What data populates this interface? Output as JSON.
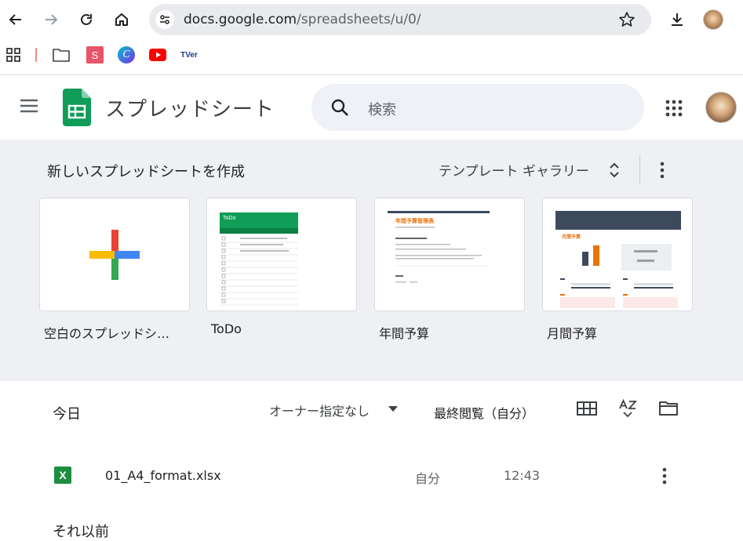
{
  "browser": {
    "url_host": "docs.google.com",
    "url_path": "/spreadsheets/u/0/",
    "icons": [
      "back-icon",
      "forward-icon",
      "reload-icon",
      "home-icon",
      "site-settings-icon",
      "star-icon",
      "download-icon",
      "profile-avatar"
    ],
    "bookmarks": [
      "apps-grid-icon",
      "folder-icon",
      "s-app-icon",
      "canva-icon",
      "youtube-icon",
      "tver-icon"
    ],
    "bookmark_texts": {
      "s": "S",
      "canva": "C",
      "tver": "TVer"
    }
  },
  "app": {
    "title": "スプレッドシート",
    "search_placeholder": "検索"
  },
  "templates": {
    "heading": "新しいスプレッドシートを作成",
    "gallery_label": "テンプレート ギャラリー",
    "cards": [
      {
        "label": "空白のスプレッドシ…"
      },
      {
        "label": "ToDo",
        "thumb_title": "ToDo"
      },
      {
        "label": "年間予算",
        "thumb_title": "年間予算管理表"
      },
      {
        "label": "月間予算",
        "thumb_title": "月間予算"
      }
    ]
  },
  "files": {
    "section_today": "今日",
    "owner_filter": "オーナー指定なし",
    "sort_label": "最終閲覧（自分）",
    "rows": [
      {
        "name": "01_A4_format.xlsx",
        "owner": "自分",
        "time": "12:43",
        "type_icon": "X"
      }
    ],
    "section_older": "それ以前"
  },
  "colors": {
    "sheets_green": "#0f9d58",
    "excel_green": "#1e8e3e",
    "template_bg": "#eef0f3",
    "search_bg": "#eef1f5"
  }
}
